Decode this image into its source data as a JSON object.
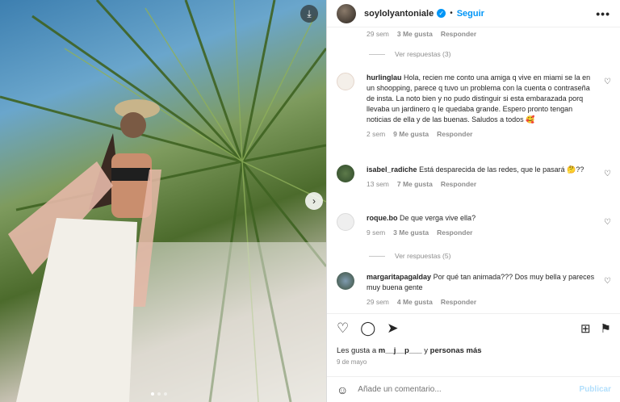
{
  "post": {
    "username": "soylolyantoniale",
    "follow_label": "Seguir",
    "more_label": "•••"
  },
  "top_meta": {
    "time": "29 sem",
    "likes": "3 Me gusta",
    "reply": "Responder"
  },
  "comments": [
    {
      "user": "hurlinglau",
      "text": "Hola, recien me conto una amiga q vive en miami se la en un shoopping, parece q tuvo un problema con la cuenta o contraseña de insta. La noto bien y no pudo distinguir si esta embarazada porq llevaba un jardinero q le quedaba grande. Espero pronto tengan noticias de ella y de las buenas. Saludos a todos 🥰",
      "time": "2 sem",
      "likes": "9 Me gusta",
      "reply": "Responder"
    },
    {
      "user": "isabel_radiche",
      "text": "Está desparecida de las redes, que le pasará 🤔??",
      "time": "13 sem",
      "likes": "7 Me gusta",
      "reply": "Responder"
    },
    {
      "user": "roque.bo",
      "text": "De que verga vive ella?",
      "time": "9 sem",
      "likes": "3 Me gusta",
      "reply": "Responder"
    },
    {
      "user": "margaritapagalday",
      "text": "Por qué tan animada??? Dos muy bella y pareces muy buena gente",
      "time": "29 sem",
      "likes": "4 Me gusta",
      "reply": "Responder"
    }
  ],
  "replies": [
    {
      "label": "Ver respuestas (3)"
    },
    {
      "label": "Ver respuestas (5)"
    }
  ],
  "likes_line": {
    "prefix": "Les gusta a",
    "user": "m__j__p___",
    "suffix": "y",
    "others": "personas más"
  },
  "date": "9 de mayo",
  "add_comment": {
    "placeholder": "Añade un comentario...",
    "publish": "Publicar"
  },
  "icons": {
    "download": "download-icon",
    "next": "chevron-right-icon",
    "verified": "verified-badge-icon",
    "heart": "heart-icon",
    "comment": "comment-icon",
    "share": "share-icon",
    "save": "bookmark-icon",
    "add_collection": "add-to-collection-icon",
    "emoji": "emoji-icon"
  },
  "colors": {
    "accent": "#0095f6",
    "muted": "#8e8e8e"
  }
}
